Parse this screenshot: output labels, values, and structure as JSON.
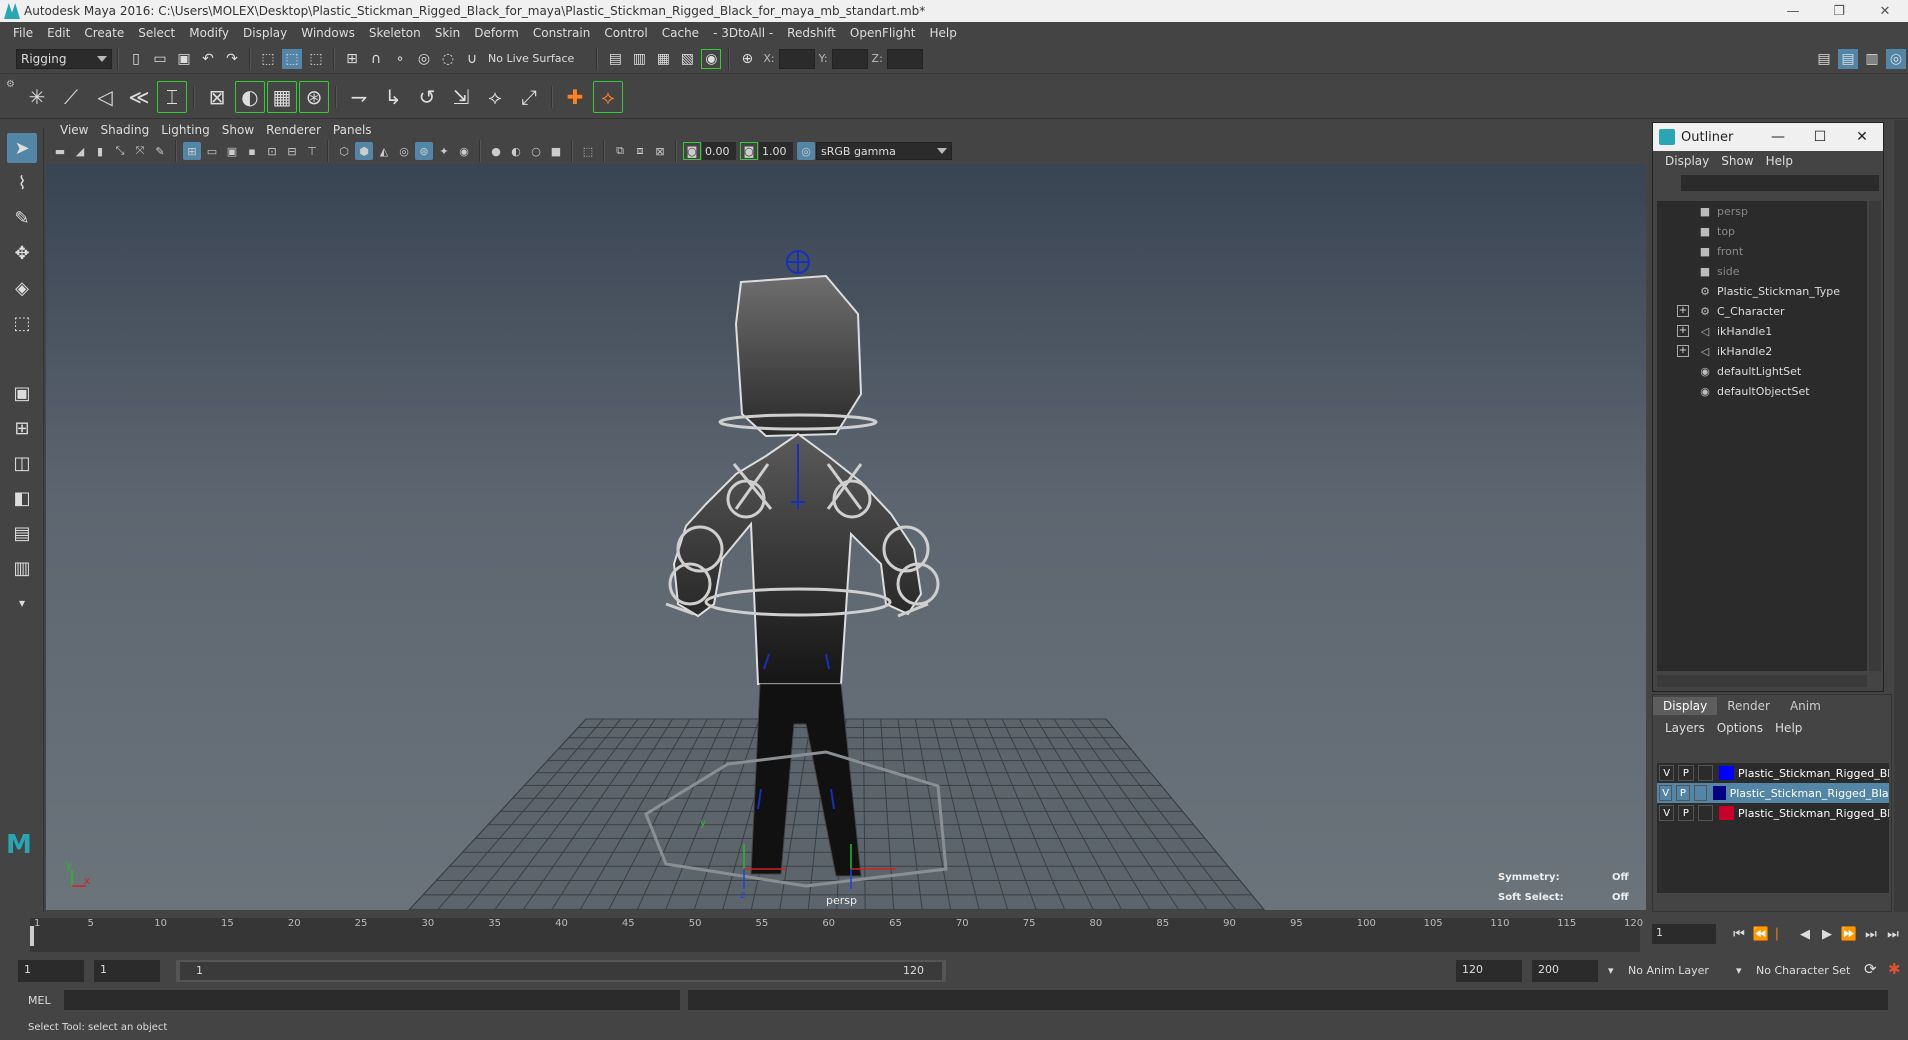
{
  "window": {
    "title": "Autodesk Maya 2016: C:\\Users\\MOLEX\\Desktop\\Plastic_Stickman_Rigged_Black_for_maya\\Plastic_Stickman_Rigged_Black_for_maya_mb_standart.mb*",
    "min": "—",
    "max": "❐",
    "close": "✕"
  },
  "menubar": [
    "File",
    "Edit",
    "Create",
    "Select",
    "Modify",
    "Display",
    "Windows",
    "Skeleton",
    "Skin",
    "Deform",
    "Constrain",
    "Control",
    "Cache",
    "- 3DtoAll -",
    "Redshift",
    "OpenFlight",
    "Help"
  ],
  "statusline": {
    "menuset": "Rigging",
    "live_surface": "No Live Surface",
    "x_label": "X:",
    "y_label": "Y:",
    "z_label": "Z:"
  },
  "panel": {
    "menus": [
      "View",
      "Shading",
      "Lighting",
      "Show",
      "Renderer",
      "Panels"
    ],
    "exposure": "0.00",
    "gamma": "1.00",
    "colorspace": "sRGB gamma"
  },
  "viewport": {
    "camera": "persp",
    "symmetry_label": "Symmetry:",
    "symmetry_value": "Off",
    "softselect_label": "Soft Select:",
    "softselect_value": "Off",
    "axis_x": "x",
    "axis_y": "y",
    "axis_z": "z"
  },
  "outliner": {
    "title": "Outliner",
    "menus": [
      "Display",
      "Show",
      "Help"
    ],
    "items": [
      {
        "label": "persp",
        "dim": true,
        "expandable": false,
        "icon": "camera-icon"
      },
      {
        "label": "top",
        "dim": true,
        "expandable": false,
        "icon": "camera-icon"
      },
      {
        "label": "front",
        "dim": true,
        "expandable": false,
        "icon": "camera-icon"
      },
      {
        "label": "side",
        "dim": true,
        "expandable": false,
        "icon": "camera-icon"
      },
      {
        "label": "Plastic_Stickman_Type",
        "dim": false,
        "expandable": false,
        "icon": "transform-icon"
      },
      {
        "label": "C_Character",
        "dim": false,
        "expandable": true,
        "icon": "transform-icon"
      },
      {
        "label": "ikHandle1",
        "dim": false,
        "expandable": true,
        "icon": "ikhandle-icon"
      },
      {
        "label": "ikHandle2",
        "dim": false,
        "expandable": true,
        "icon": "ikhandle-icon"
      },
      {
        "label": "defaultLightSet",
        "dim": false,
        "expandable": false,
        "icon": "set-icon"
      },
      {
        "label": "defaultObjectSet",
        "dim": false,
        "expandable": false,
        "icon": "set-icon"
      }
    ]
  },
  "layers": {
    "tabs": [
      "Display",
      "Render",
      "Anim"
    ],
    "menus": [
      "Layers",
      "Options",
      "Help"
    ],
    "rows": [
      {
        "v": "V",
        "p": "P",
        "color": "#0000ff",
        "name": "Plastic_Stickman_Rigged_Bla",
        "selected": false
      },
      {
        "v": "V",
        "p": "P",
        "color": "#000080",
        "name": "Plastic_Stickman_Rigged_Black_FBX",
        "selected": true
      },
      {
        "v": "V",
        "p": "P",
        "color": "#c8002a",
        "name": "Plastic_Stickman_Rigged_Bla",
        "selected": false
      }
    ]
  },
  "timeline": {
    "ticks": [
      "1",
      "5",
      "10",
      "15",
      "20",
      "25",
      "30",
      "35",
      "40",
      "45",
      "50",
      "55",
      "60",
      "65",
      "70",
      "75",
      "80",
      "85",
      "90",
      "95",
      "100",
      "105",
      "110",
      "115",
      "120"
    ],
    "current_frame": "1"
  },
  "range": {
    "start": "1",
    "anim_start": "1",
    "range_start": "1",
    "range_end": "120",
    "end": "120",
    "anim_end": "200",
    "anim_layer": "No Anim Layer",
    "char_set": "No Character Set"
  },
  "cmdline": {
    "mode": "MEL"
  },
  "helpline": {
    "text": "Select Tool: select an object"
  },
  "colors": {
    "accent": "#5285a6",
    "bg": "#444444",
    "field": "#2b2b2b"
  }
}
